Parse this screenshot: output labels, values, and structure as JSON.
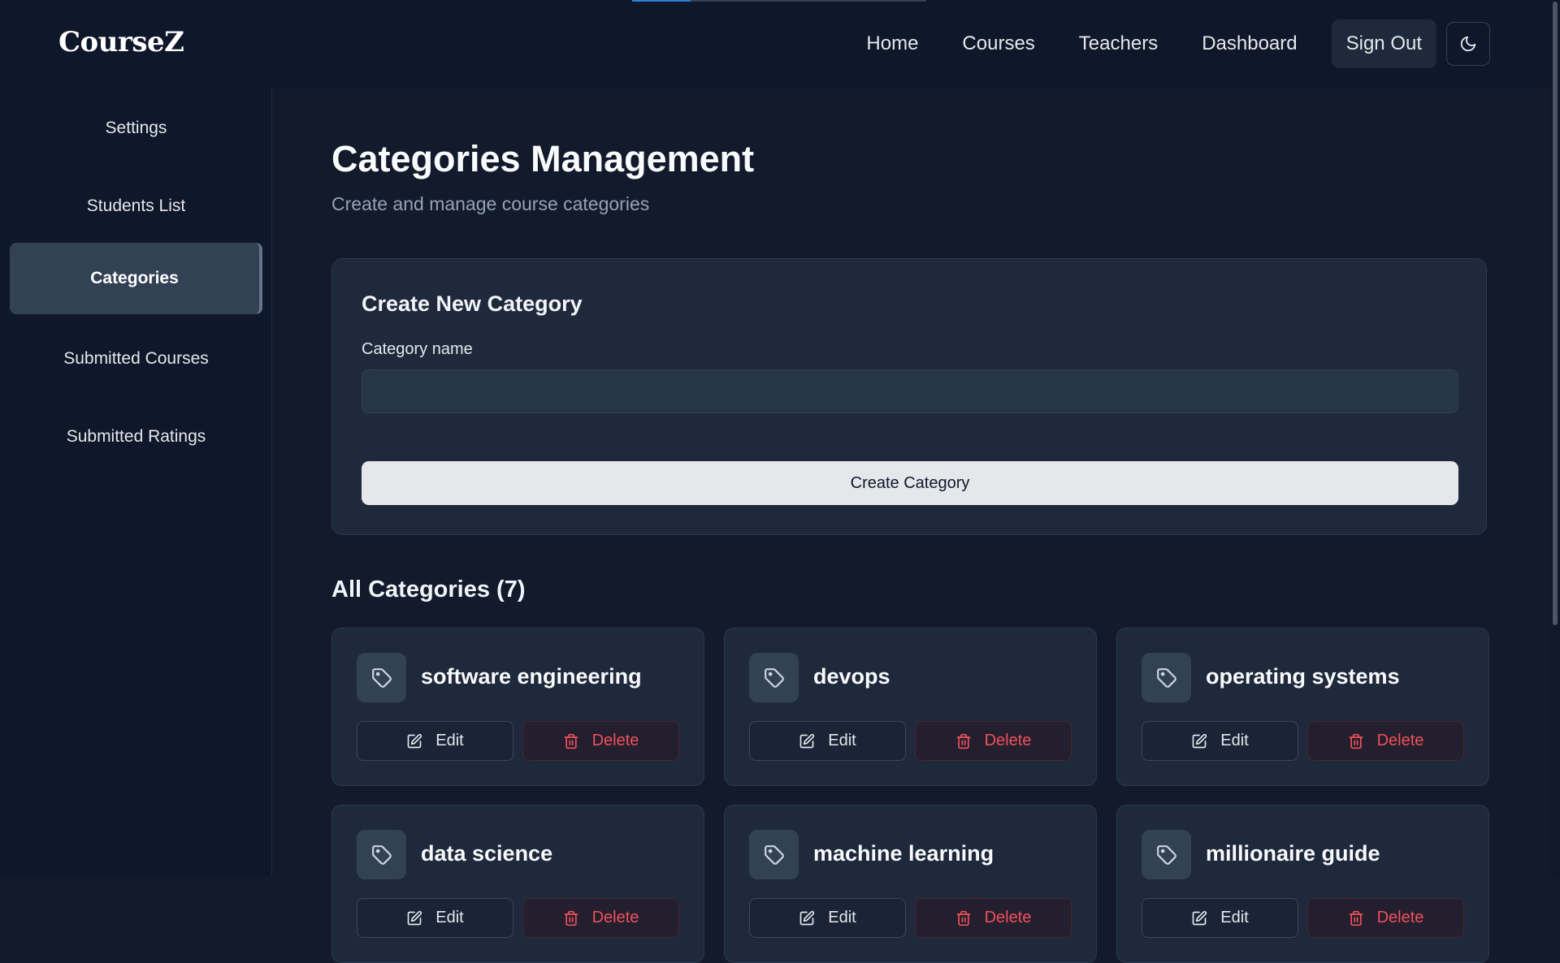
{
  "app": {
    "logo": "CourseZ",
    "loading_progress": 0.2
  },
  "nav": {
    "links": [
      "Home",
      "Courses",
      "Teachers",
      "Dashboard"
    ],
    "sign_out": "Sign Out",
    "theme_icon": "moon-icon"
  },
  "sidebar": {
    "items": [
      {
        "label": "Settings",
        "active": false
      },
      {
        "label": "Students List",
        "active": false
      },
      {
        "label": "Categories",
        "active": true
      },
      {
        "label": "Submitted Courses",
        "active": false
      },
      {
        "label": "Submitted Ratings",
        "active": false
      }
    ]
  },
  "page": {
    "title": "Categories Management",
    "subtitle": "Create and manage course categories"
  },
  "create_form": {
    "title": "Create New Category",
    "label": "Category name",
    "value": "",
    "placeholder": "",
    "button": "Create Category"
  },
  "categories": {
    "heading": "All Categories (7)",
    "edit_label": "Edit",
    "delete_label": "Delete",
    "items": [
      "software engineering",
      "devops",
      "operating systems",
      "data science",
      "machine learning",
      "millionaire guide"
    ]
  },
  "colors": {
    "background": "#121a2b",
    "card": "#1e293b",
    "danger": "#f0505a",
    "accent": "#2f7fd6"
  }
}
